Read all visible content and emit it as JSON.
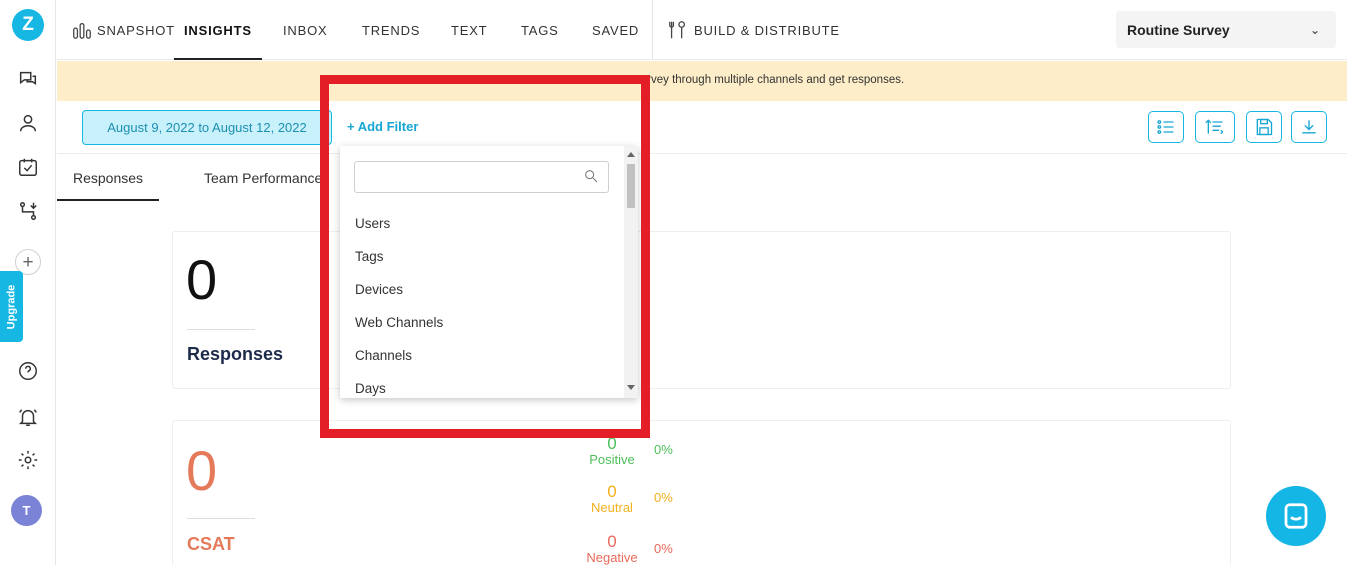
{
  "rail": {
    "logo": "Z",
    "upgrade_label": "Upgrade",
    "avatar_initial": "T"
  },
  "nav": {
    "snapshot": "SNAPSHOT",
    "insights": "INSIGHTS",
    "inbox": "INBOX",
    "trends": "TRENDS",
    "text": "TEXT",
    "tags": "TAGS",
    "saved": "SAVED",
    "build_distribute": "BUILD & DISTRIBUTE",
    "survey_select": "Routine Survey"
  },
  "banner": {
    "text_visible": "r survey through multiple channels and get responses."
  },
  "toolbar": {
    "date_range": "August 9, 2022 to August 12, 2022",
    "add_filter": "+ Add Filter"
  },
  "tabs": {
    "responses": "Responses",
    "team_performance": "Team Performance"
  },
  "responses_card": {
    "count": "0",
    "label": "Responses"
  },
  "csat_card": {
    "score": "0",
    "label": "CSAT",
    "metrics": [
      {
        "value": "0",
        "label": "Positive",
        "percent": "0%",
        "color": "#4cbf5a"
      },
      {
        "value": "0",
        "label": "Neutral",
        "percent": "0%",
        "color": "#f2b01e"
      },
      {
        "value": "0",
        "label": "Negative",
        "percent": "0%",
        "color": "#e96a5a"
      }
    ]
  },
  "filter_dropdown": {
    "search_value": "",
    "items": [
      "Users",
      "Tags",
      "Devices",
      "Web Channels",
      "Channels",
      "Days"
    ]
  },
  "colors": {
    "accent": "#16b7e3",
    "banner": "#fdeec9",
    "highlight": "#e41e26"
  }
}
